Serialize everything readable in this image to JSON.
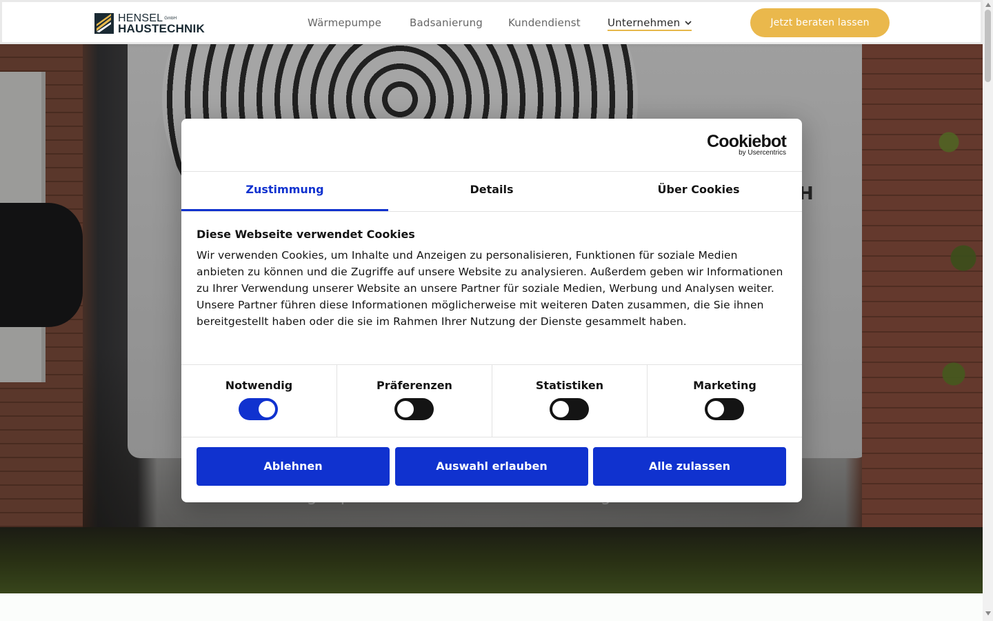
{
  "header": {
    "logo": {
      "line1": "HENSEL",
      "gmbh": "GmbH",
      "line2": "HAUSTECHNIK"
    },
    "nav": [
      {
        "label": "Wärmepumpe"
      },
      {
        "label": "Badsanierung"
      },
      {
        "label": "Kundendienst"
      },
      {
        "label": "Unternehmen",
        "has_dropdown": true,
        "active": true
      }
    ],
    "cta_label": "Jetzt beraten lassen"
  },
  "hero": {
    "subtitle": "Energiesparend. Umweltfreundlich. Maßgeschneidert.",
    "partial_letter": "H"
  },
  "cookie_dialog": {
    "brand": {
      "name": "Cookiebot",
      "by": "by Usercentrics"
    },
    "tabs": [
      {
        "label": "Zustimmung",
        "active": true
      },
      {
        "label": "Details",
        "active": false
      },
      {
        "label": "Über Cookies",
        "active": false
      }
    ],
    "title": "Diese Webseite verwendet Cookies",
    "text": "Wir verwenden Cookies, um Inhalte und Anzeigen zu personalisieren, Funktionen für soziale Medien anbieten zu können und die Zugriffe auf unsere Website zu analysieren. Außerdem geben wir Informationen zu Ihrer Verwendung unserer Website an unsere Partner für soziale Medien, Werbung und Analysen weiter. Unsere Partner führen diese Informationen möglicherweise mit weiteren Daten zusammen, die Sie ihnen bereitgestellt haben oder die sie im Rahmen Ihrer Nutzung der Dienste gesammelt haben.",
    "toggles": [
      {
        "label": "Notwendig",
        "on": true
      },
      {
        "label": "Präferenzen",
        "on": false
      },
      {
        "label": "Statistiken",
        "on": false
      },
      {
        "label": "Marketing",
        "on": false
      }
    ],
    "buttons": {
      "deny": "Ablehnen",
      "allow_selection": "Auswahl erlauben",
      "allow_all": "Alle zulassen"
    }
  },
  "colors": {
    "accent_blue": "#1032cf",
    "cta_yellow": "#eab84c",
    "active_underline": "#e6b74a"
  }
}
